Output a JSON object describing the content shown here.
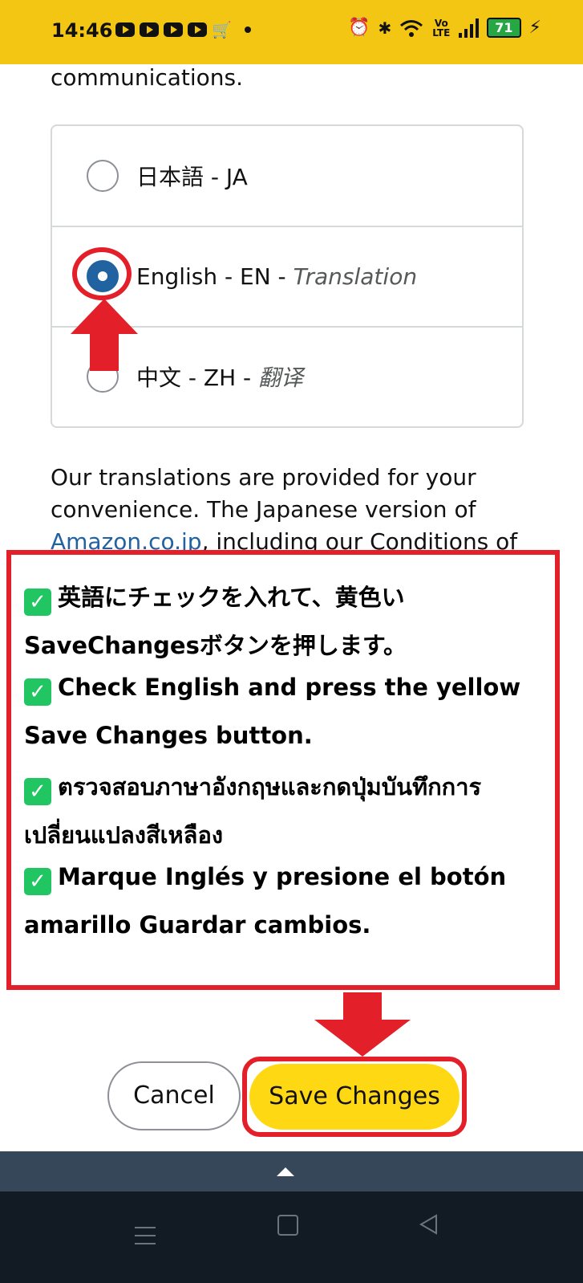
{
  "status_bar": {
    "time": "14:46",
    "network_label": "Vo LTE",
    "battery": "71"
  },
  "content": {
    "intro_tail": "communications.",
    "languages": [
      {
        "label": "日本語 - JA",
        "translation": "",
        "selected": false
      },
      {
        "label": "English - EN - ",
        "translation": "Translation",
        "selected": true
      },
      {
        "label": "中文 - ZH - ",
        "translation": "翻译",
        "selected": false
      }
    ],
    "note_prefix": "Our translations are provided for your convenience. The Japanese version of ",
    "note_link": "Amazon.co.jp",
    "note_suffix": ", including our Conditions of"
  },
  "instructions": [
    "英語にチェックを入れて、黄色い",
    "SaveChangesボタンを押します。",
    "Check English and press the yellow",
    "Save Changes button.",
    "ตรวจสอบภาษาอังกฤษและกดปุ่มบันทึกการ",
    "เปลี่ยนแปลงสีเหลือง",
    "Marque Inglés y presione el botón",
    "amarillo Guardar cambios."
  ],
  "buttons": {
    "cancel": "Cancel",
    "save": "Save Changes"
  },
  "colors": {
    "status_bar": "#f3c614",
    "accent_red": "#e3202a",
    "save_button": "#ffd814",
    "radio_selected": "#2162a1",
    "check_green": "#21c663",
    "nav_bar": "#121a24",
    "sheet_bar": "#37475a"
  }
}
